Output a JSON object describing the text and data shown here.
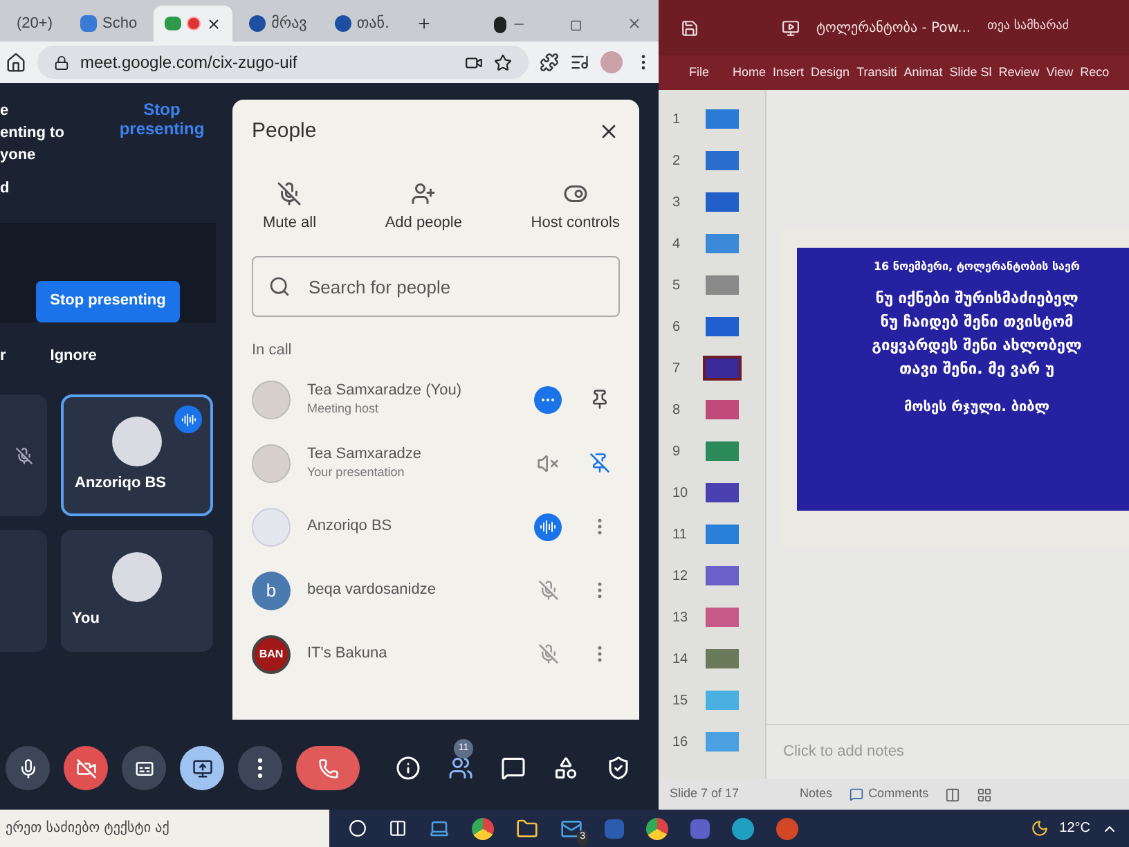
{
  "browser": {
    "tabs": [
      {
        "label": "(20+)",
        "kind": "plain",
        "selected": false
      },
      {
        "label": "Scho",
        "kind": "app",
        "selected": false
      },
      {
        "kind": "meet",
        "recording": true,
        "selected": true
      },
      {
        "label": "მრავ",
        "kind": "site",
        "selected": false
      },
      {
        "label": "თან.",
        "kind": "site",
        "selected": false
      }
    ],
    "address": "meet.google.com/cix-zugo-uif"
  },
  "meet": {
    "notice_lines": [
      "e",
      "enting to",
      "yone"
    ],
    "notice_link": "Stop presenting",
    "side_letter": "d",
    "stop_button": "Stop presenting",
    "cut_letter": "r",
    "ignore": "Ignore",
    "tiles": [
      {
        "name": "Anzoriqo BS",
        "speaking": true
      },
      {
        "name": "You",
        "speaking": false
      }
    ],
    "people": {
      "title": "People",
      "actions": [
        {
          "kind": "mute",
          "label": "Mute all"
        },
        {
          "kind": "add",
          "label": "Add people"
        },
        {
          "kind": "host",
          "label": "Host controls"
        }
      ],
      "search": {
        "placeholder": "Search for people"
      },
      "section": "In call",
      "participants": [
        {
          "name": "Tea Samxaradze (You)",
          "subtitle": "Meeting host",
          "avatar": {
            "kind": "photo"
          },
          "audio": {
            "kind": "options"
          },
          "action": {
            "kind": "pin"
          }
        },
        {
          "name": "Tea Samxaradze",
          "subtitle": "Your presentation",
          "avatar": {
            "kind": "photo"
          },
          "audio": {
            "kind": "sound-off"
          },
          "action": {
            "kind": "unpin"
          }
        },
        {
          "name": "Anzoriqo BS",
          "avatar": {
            "kind": "logo"
          },
          "audio": {
            "kind": "speaking"
          },
          "action": {
            "kind": "more"
          }
        },
        {
          "name": "beqa vardosanidze",
          "avatar": {
            "kind": "letter",
            "letter": "b"
          },
          "audio": {
            "kind": "muted"
          },
          "action": {
            "kind": "more"
          }
        },
        {
          "name": "IT's Bakuna",
          "avatar": {
            "kind": "badge",
            "badge": "BAN"
          },
          "audio": {
            "kind": "muted"
          },
          "action": {
            "kind": "more"
          }
        }
      ]
    },
    "controls": [
      {
        "kind": "mic"
      },
      {
        "kind": "camera-off"
      },
      {
        "kind": "captions"
      },
      {
        "kind": "present",
        "active": true
      },
      {
        "kind": "more"
      },
      {
        "kind": "hangup"
      }
    ],
    "side_controls": [
      {
        "kind": "info"
      },
      {
        "kind": "people",
        "count": "11"
      },
      {
        "kind": "chat"
      },
      {
        "kind": "activities"
      },
      {
        "kind": "safety"
      }
    ]
  },
  "powerpoint": {
    "title": "ტოლერანტობა - Pow...",
    "user": "თეა სამხარაძ",
    "ribbon": [
      {
        "label": "File",
        "selected": false
      },
      {
        "label": "Home",
        "selected": false
      },
      {
        "label": "Insert",
        "selected": false
      },
      {
        "label": "Design",
        "selected": false
      },
      {
        "label": "Transiti",
        "selected": false
      },
      {
        "label": "Animat",
        "selected": false
      },
      {
        "label": "Slide Sl",
        "selected": false
      },
      {
        "label": "Review",
        "selected": false
      },
      {
        "label": "View",
        "selected": false
      },
      {
        "label": "Reco",
        "selected": false
      }
    ],
    "thumbnails": [
      {
        "number": "1",
        "color": "#2a7ad8",
        "selected": false
      },
      {
        "number": "2",
        "color": "#2a6fd0",
        "selected": false
      },
      {
        "number": "3",
        "color": "#2060c8",
        "selected": false
      },
      {
        "number": "4",
        "color": "#3a8ad8",
        "selected": false
      },
      {
        "number": "5",
        "color": "#8a8a8a",
        "selected": false
      },
      {
        "number": "6",
        "color": "#1f5fd0",
        "selected": false
      },
      {
        "number": "7",
        "color": "#3a2a9a",
        "selected": true
      },
      {
        "number": "8",
        "color": "#c04a7a",
        "selected": false
      },
      {
        "number": "9",
        "color": "#2a8a5a",
        "selected": false
      },
      {
        "number": "10",
        "color": "#4a40b0",
        "selected": false
      },
      {
        "number": "11",
        "color": "#2a80d8",
        "selected": false
      },
      {
        "number": "12",
        "color": "#6a60c8",
        "selected": false
      },
      {
        "number": "13",
        "color": "#c85a8a",
        "selected": false
      },
      {
        "number": "14",
        "color": "#6a7a5a",
        "selected": false
      },
      {
        "number": "15",
        "color": "#4ab0e0",
        "selected": false
      },
      {
        "number": "16",
        "color": "#4aa0e0",
        "selected": false
      }
    ],
    "slide": {
      "heading": "16 ნოემბერი, ტოლერანტობის საერ",
      "verse_lines": [
        "ნუ იქნები შურისმაძიებელ",
        "ნუ ჩაიდებ შენი თვისტომ",
        "გიყვარდეს შენი ახლობელ",
        "თავი შენი. მე ვარ უ"
      ],
      "source": "მოსეს რჯული. ბიბლ"
    },
    "notes_placeholder": "Click to add notes",
    "status": {
      "slide": "Slide 7 of 17",
      "notes": "Notes",
      "comments": "Comments"
    }
  },
  "taskbar": {
    "search": "ერეთ საძიებო ტექსტი აქ",
    "mail_count": "3",
    "temperature": "12°C"
  }
}
